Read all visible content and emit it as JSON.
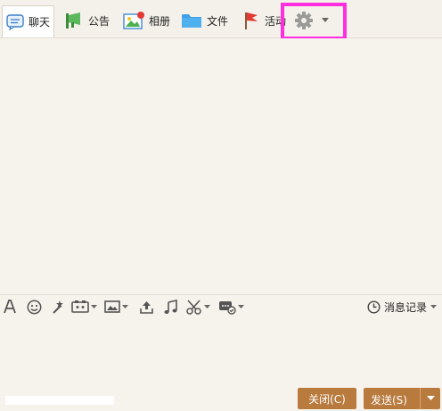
{
  "tabs": [
    {
      "label": "聊天",
      "icon": "chat-bubble-icon",
      "active": true
    },
    {
      "label": "公告",
      "icon": "megaphone-icon"
    },
    {
      "label": "相册",
      "icon": "photo-album-icon"
    },
    {
      "label": "文件",
      "icon": "folder-icon"
    },
    {
      "label": "活动",
      "icon": "flag-icon"
    }
  ],
  "settings": {
    "icon": "gear-icon"
  },
  "toolbar": {
    "tools": [
      "font-icon",
      "emoji-icon",
      "magic-wand-icon",
      "screen-share-icon",
      "image-icon",
      "upload-icon",
      "music-icon",
      "scissors-icon",
      "more-apps-icon"
    ],
    "history_label": "消息记录"
  },
  "buttons": {
    "close_label": "关闭(C)",
    "send_label": "发送(S)"
  },
  "colors": {
    "accent": "#b97a3e",
    "highlight": "#ff2fe0",
    "background": "#f6f3ec"
  }
}
